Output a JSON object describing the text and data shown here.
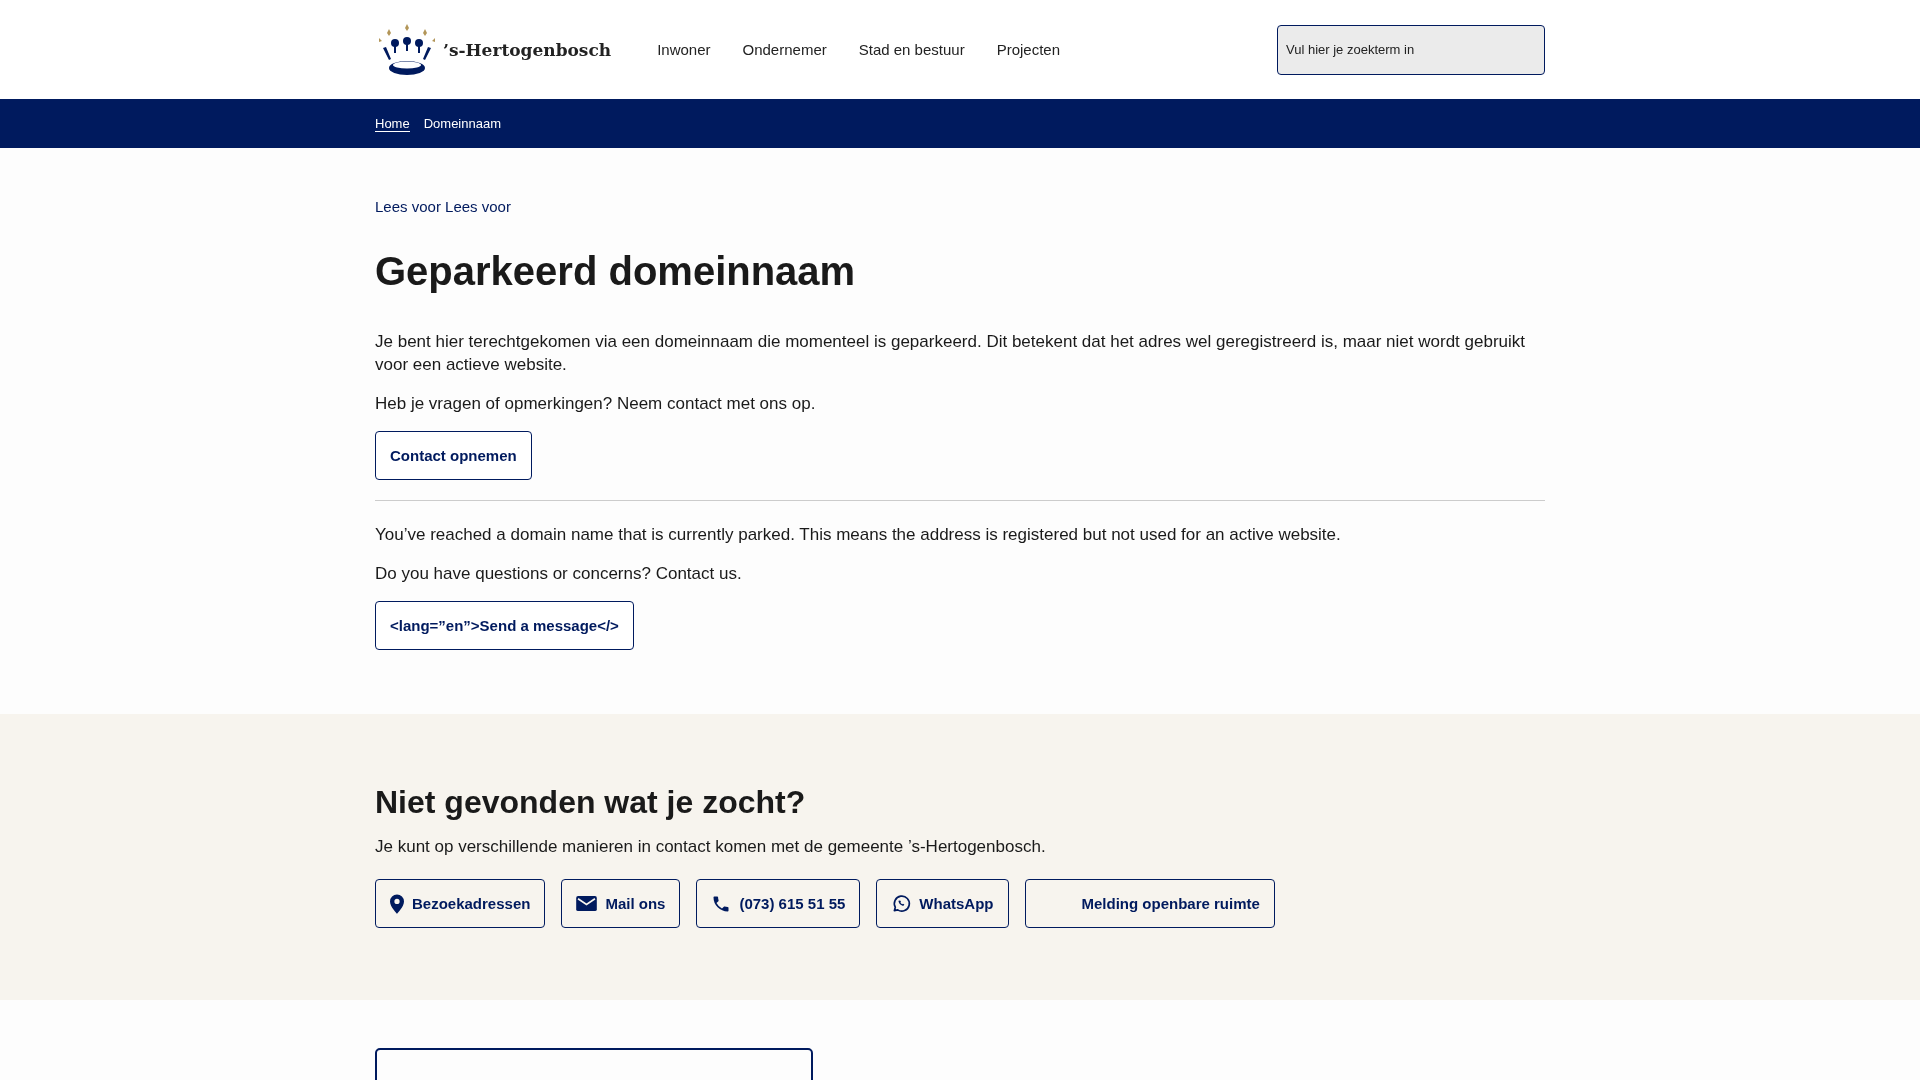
{
  "header": {
    "logo_text": "’s-Hertogenbosch",
    "nav": [
      {
        "label": "Inwoner"
      },
      {
        "label": "Ondernemer"
      },
      {
        "label": "Stad en bestuur"
      },
      {
        "label": "Projecten"
      }
    ],
    "search": {
      "placeholder": "Vul hier je zoekterm in"
    }
  },
  "breadcrumb": [
    {
      "label": "Home",
      "link": true
    },
    {
      "label": "Domeinnaam",
      "link": false
    }
  ],
  "read_aloud": "Lees voor Lees voor",
  "title": "Geparkeerd domeinnaam",
  "nl": {
    "paragraphs": [
      "Je bent hier terechtgekomen via een domeinnaam die momenteel is geparkeerd. Dit betekent dat het adres wel geregistreerd is, maar niet wordt gebruikt voor een actieve website.",
      "Heb je vragen of opmerkingen? Neem contact met ons op."
    ],
    "button": "Contact opnemen"
  },
  "en": {
    "paragraphs": [
      "You’ve reached a domain name that is currently parked. This means the address is registered but not used for an active website.",
      "Do you have questions or concerns? Contact us."
    ],
    "button": "<lang=”en”>Send a message</>"
  },
  "contact": {
    "title": "Niet gevonden wat je zocht?",
    "text": "Je kunt op verschillende manieren in contact komen met de gemeente ’s-Hertogenbosch.",
    "buttons": [
      {
        "label": "Bezoekadressen",
        "kind": "pin"
      },
      {
        "label": "Mail ons",
        "kind": "mail"
      },
      {
        "label": "(073) 615 51 55",
        "kind": "phone"
      },
      {
        "label": "WhatsApp",
        "kind": "whatsapp"
      },
      {
        "label": "Melding openbare ruimte",
        "kind": "blank"
      }
    ]
  }
}
